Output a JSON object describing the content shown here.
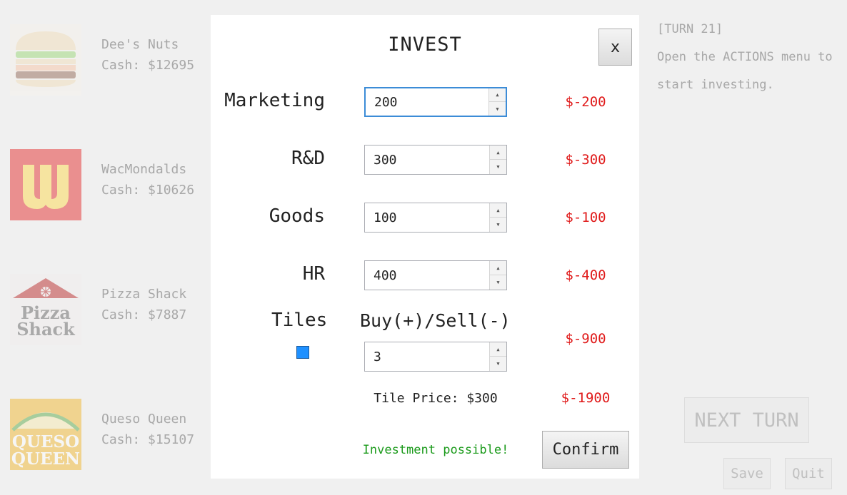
{
  "companies": [
    {
      "name": "Dee's Nuts",
      "cash": "Cash: $12695",
      "logo": "burger-logo"
    },
    {
      "name": "WacMondalds",
      "cash": "Cash: $10626",
      "logo": "wacmondalds-logo",
      "logo_text": "W"
    },
    {
      "name": "Pizza Shack",
      "cash": "Cash: $7887",
      "logo": "pizza-shack-logo",
      "logo_text": [
        "Pizza",
        "Shack"
      ]
    },
    {
      "name": "Queso Queen",
      "cash": "Cash: $15107",
      "logo": "queso-queen-logo",
      "logo_text": [
        "QUESO",
        "QUEEN"
      ]
    }
  ],
  "side": {
    "turn": "[TURN 21]",
    "message": "Open the ACTIONS menu to start investing.",
    "next_turn": "NEXT TURN",
    "save": "Save",
    "quit": "Quit"
  },
  "invest": {
    "title": "INVEST",
    "close": "x",
    "rows": [
      {
        "label": "Marketing",
        "value": "200",
        "cost": "$-200"
      },
      {
        "label": "R&D",
        "value": "300",
        "cost": "$-300"
      },
      {
        "label": "Goods",
        "value": "100",
        "cost": "$-100"
      },
      {
        "label": "HR",
        "value": "400",
        "cost": "$-400"
      }
    ],
    "tiles": {
      "label": "Tiles",
      "buy_sell_label": "Buy(+)/Sell(-)",
      "value": "3",
      "cost": "$-900",
      "color": "#1e90ff"
    },
    "tile_price": "Tile Price: $300",
    "total_cost": "$-1900",
    "status": "Investment possible!",
    "confirm": "Confirm"
  },
  "colors": {
    "cost_red": "#e01a1a",
    "status_green": "#1a9a1a",
    "focus_blue": "#3c8cd7"
  }
}
